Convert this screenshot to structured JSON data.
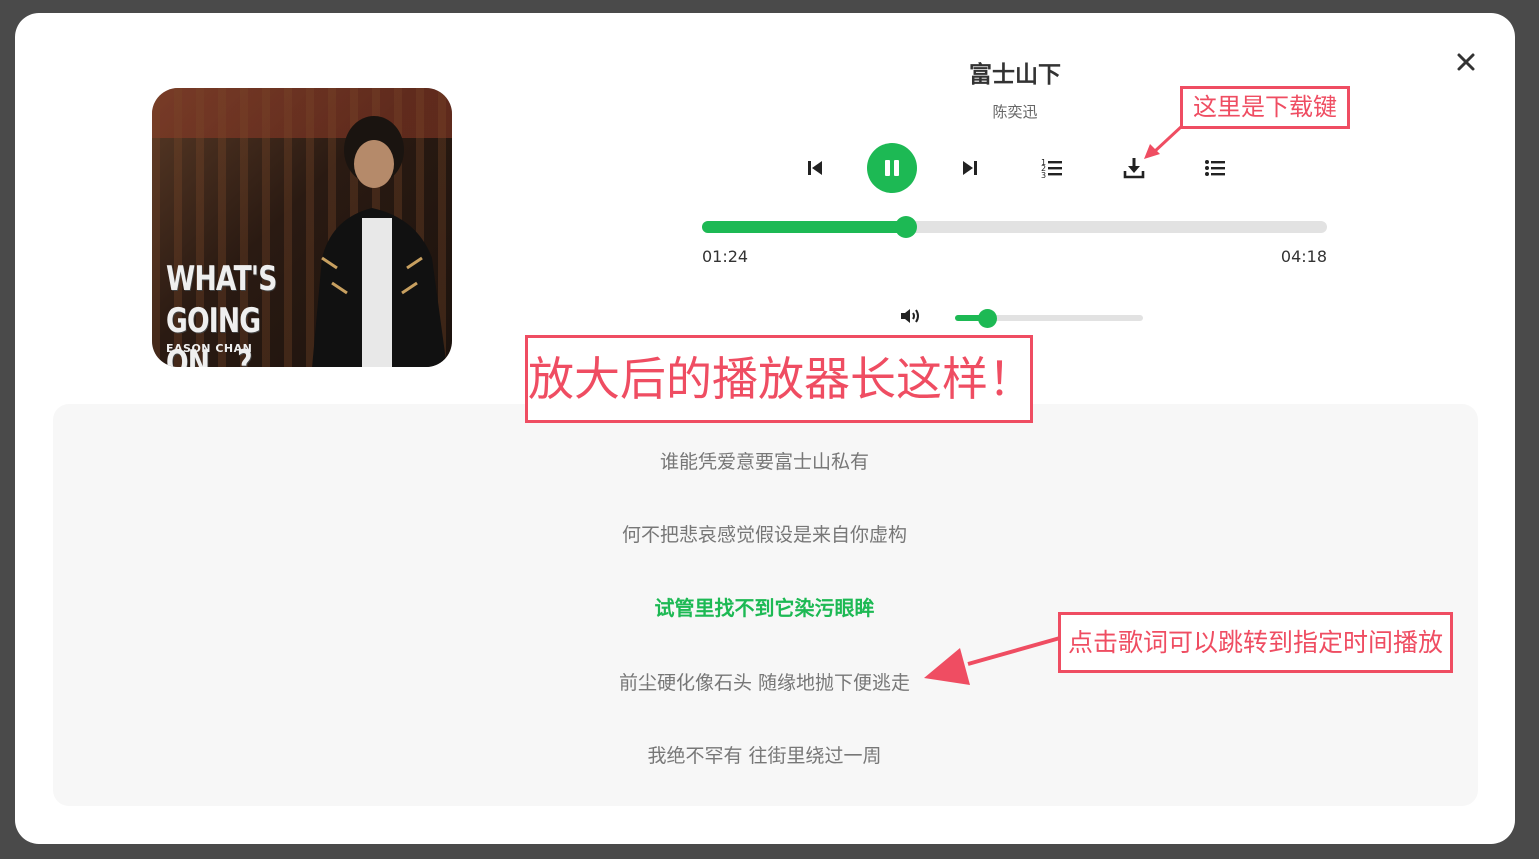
{
  "player": {
    "song_title": "富士山下",
    "artist": "陈奕迅",
    "current_time": "01:24",
    "total_time": "04:18",
    "progress_fraction": 0.327,
    "volume_fraction": 0.17,
    "is_playing": true,
    "accent_color": "#1db954"
  },
  "cover": {
    "title_line1": "WHAT'S",
    "title_line2": "GOING ON...?",
    "artist_text": "EASON CHAN"
  },
  "controls": {
    "icons": [
      "skip-previous-icon",
      "pause-icon",
      "skip-next-icon",
      "numbered-list-icon",
      "download-icon",
      "playlist-icon"
    ]
  },
  "lyrics": {
    "lines": [
      "谁能凭爱意要富士山私有",
      "何不把悲哀感觉假设是来自你虚构",
      "试管里找不到它染污眼眸",
      "前尘硬化像石头 随缘地抛下便逃走",
      "我绝不罕有 往街里绕过一周"
    ],
    "active_index": 2
  },
  "annotations": {
    "download_note": "这里是下载键",
    "enlarged_note": "放大后的播放器长这样！",
    "lyric_note": "点击歌词可以跳转到指定时间播放",
    "color": "#ef4d62"
  }
}
